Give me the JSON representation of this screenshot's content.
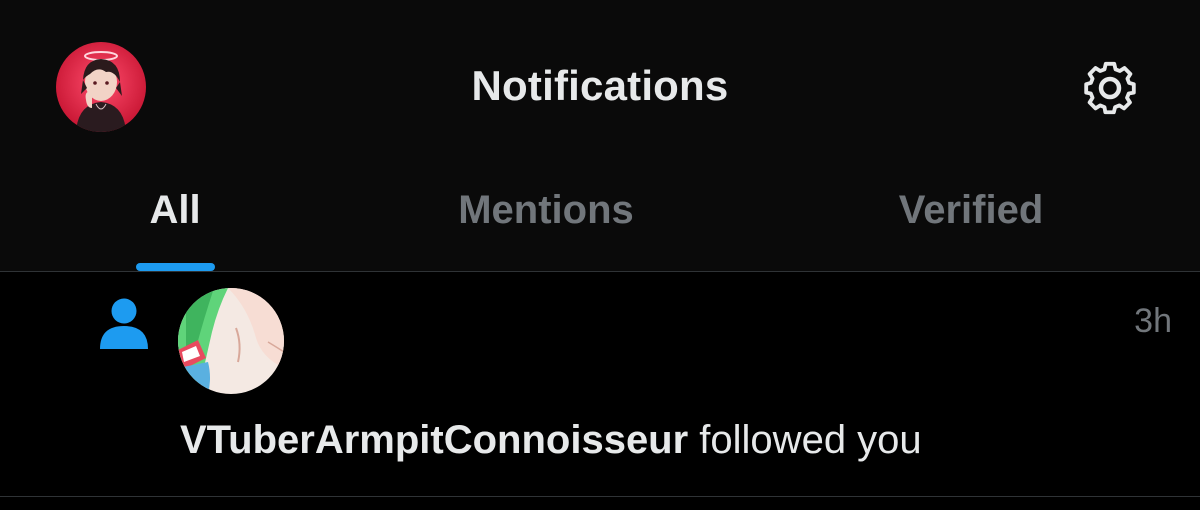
{
  "header": {
    "title": "Notifications",
    "avatar_icon": "profile-avatar",
    "settings_icon": "gear-icon"
  },
  "tabs": [
    {
      "label": "All",
      "active": true
    },
    {
      "label": "Mentions",
      "active": false
    },
    {
      "label": "Verified",
      "active": false
    }
  ],
  "notification": {
    "type_icon": "person-icon",
    "username": "VTuberArmpitConnoisseur",
    "action": " followed you",
    "time": "3h"
  },
  "colors": {
    "accent": "#1d9bf0",
    "text_primary": "#e7e9ea",
    "text_secondary": "#71767b",
    "background": "#000000",
    "divider": "#2f3336"
  }
}
